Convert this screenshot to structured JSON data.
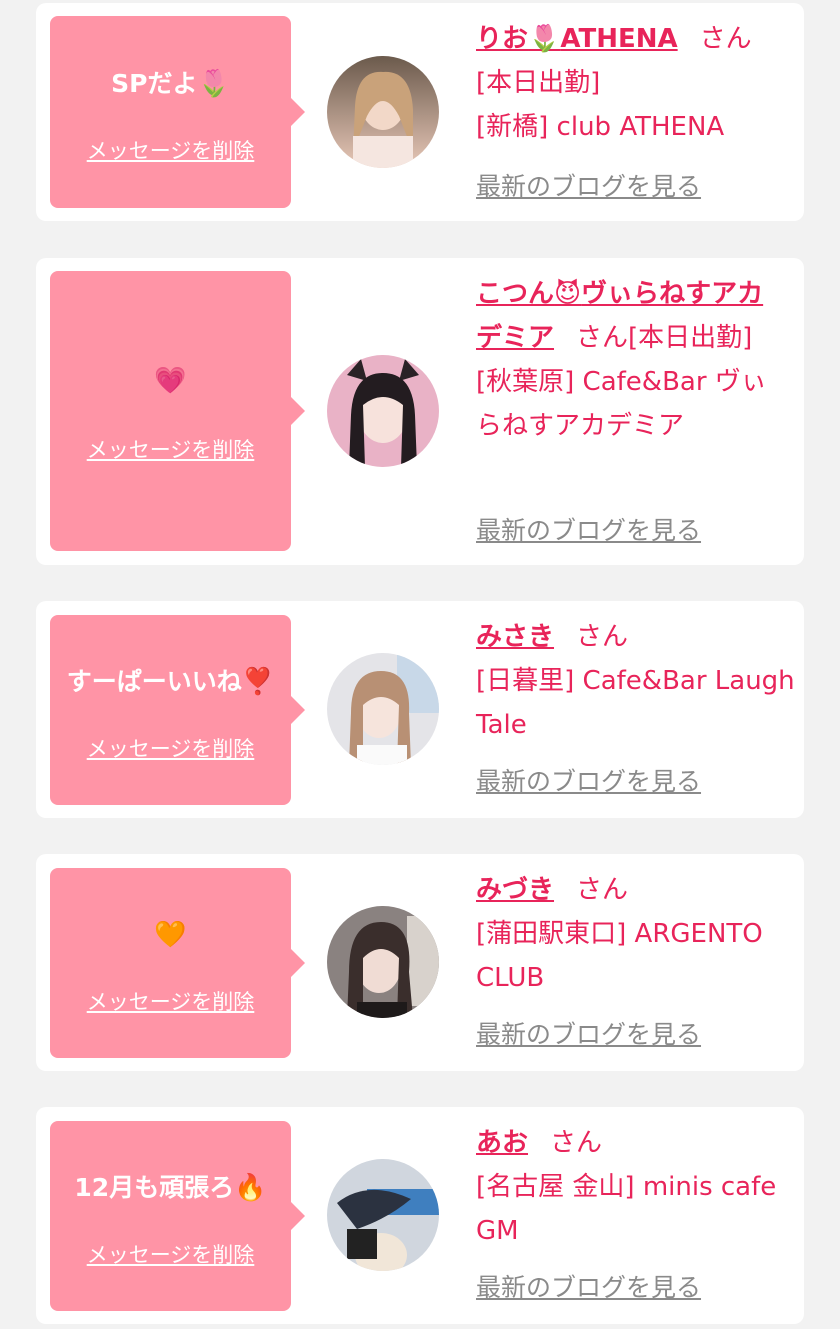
{
  "colors": {
    "bubble": "#ff94a6",
    "accent": "#e8245a",
    "link_gray": "#8a8a8a",
    "bg": "#f2f2f2"
  },
  "labels": {
    "delete": "メッセージを削除",
    "blog": "最新のブログを見る",
    "honorific": "さん"
  },
  "cards": [
    {
      "message": "SPだよ",
      "message_emoji": "🌷",
      "name_pre": "りお",
      "name_emoji": "🌷",
      "name_post": "ATHENA",
      "status": "[本日出勤]",
      "shop": "[新橋] club ATHENA",
      "avatar": "avatar-photo"
    },
    {
      "message": "",
      "message_emoji": "💗",
      "name_pre": "こつん",
      "name_emoji": "😈",
      "name_post": "ヴぃらねすアカデミア",
      "status": "[本日出勤]",
      "shop": "[秋葉原] Cafe&Bar ヴぃらねすアカデミア",
      "avatar": "avatar-photo"
    },
    {
      "message": "すーぱーいいね",
      "message_emoji": "❣️",
      "name_pre": "みさき",
      "name_emoji": "",
      "name_post": "",
      "status": "",
      "shop": "[日暮里] Cafe&Bar Laugh Tale",
      "avatar": "avatar-photo"
    },
    {
      "message": "",
      "message_emoji": "🧡",
      "name_pre": "みづき",
      "name_emoji": "",
      "name_post": "",
      "status": "",
      "shop": "[蒲田駅東口] ARGENTO CLUB",
      "avatar": "avatar-photo"
    },
    {
      "message": "12月も頑張ろ",
      "message_emoji": "🔥",
      "name_pre": "あお",
      "name_emoji": "",
      "name_post": "",
      "status": "",
      "shop": "[名古屋 金山] minis cafe GM",
      "avatar": "avatar-photo"
    }
  ]
}
